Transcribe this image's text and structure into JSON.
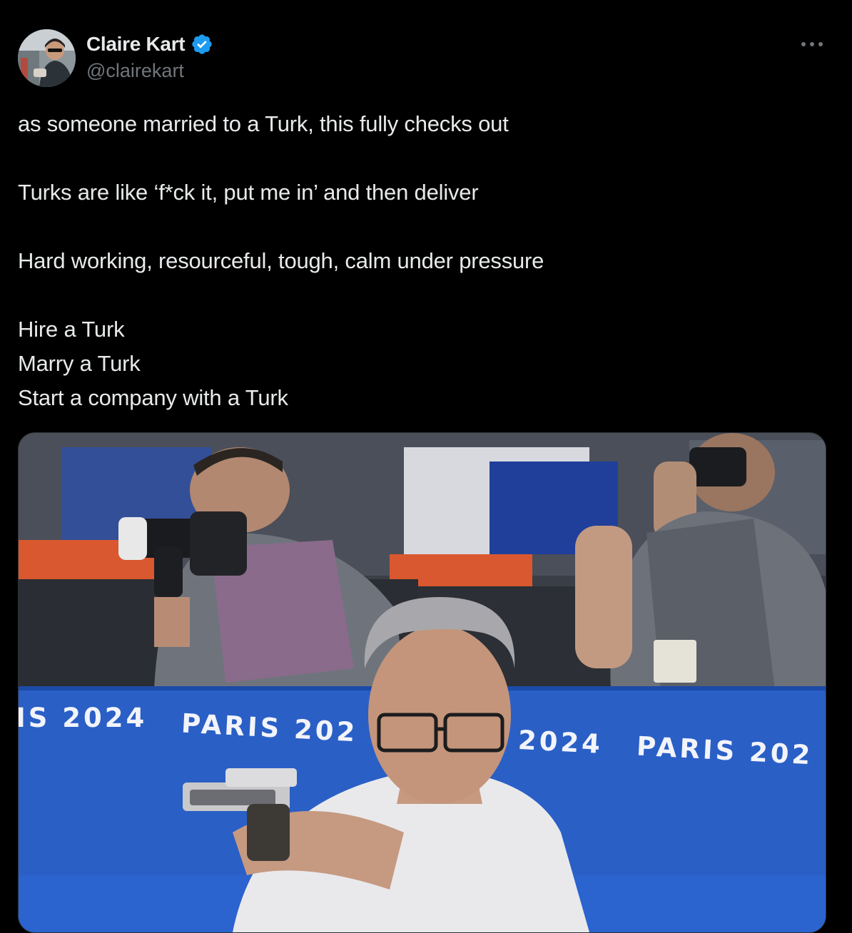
{
  "author": {
    "display_name": "Claire Kart",
    "handle": "@clairekart",
    "verified": true,
    "avatar_icon": "avatar-photo",
    "verified_icon": "verified-badge-icon"
  },
  "more_icon": "more-options-icon",
  "tweet": {
    "lines": [
      "as someone married to a Turk, this fully checks out",
      "Turks are like ‘f*ck it, put me in’ and then deliver",
      "Hard working, resourceful, tough, calm under pressure",
      "Hire a Turk",
      "Marry a Turk",
      "Start a company with a Turk"
    ]
  },
  "media": {
    "banner_texts": [
      "IS 2024",
      "PARIS 202",
      "2024",
      "PARIS 202"
    ]
  },
  "colors": {
    "background": "#000000",
    "text": "#e7e9ea",
    "muted": "#71767b",
    "verified": "#1d9bf0",
    "banner_blue": "#2a5fc6"
  }
}
